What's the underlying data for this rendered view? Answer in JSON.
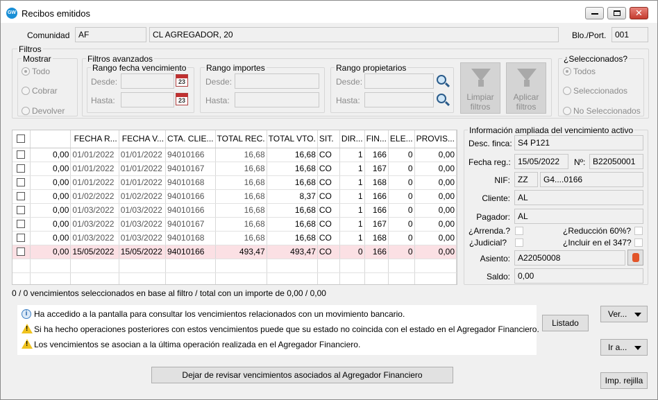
{
  "window": {
    "title": "Recibos emitidos",
    "app_icon_text": "GW"
  },
  "header": {
    "comunidad_label": "Comunidad",
    "comunidad_code": "AF",
    "comunidad_name": "CL AGREGADOR, 20",
    "bloport_label": "Blo./Port.",
    "bloport_value": "001"
  },
  "filtros": {
    "title": "Filtros",
    "mostrar": {
      "title": "Mostrar",
      "options": [
        "Todo",
        "Cobrar",
        "Devolver"
      ],
      "selected": "Todo"
    },
    "avanzados_title": "Filtros avanzados",
    "rango_fecha": {
      "title": "Rango fecha vencimiento",
      "desde": "Desde:",
      "hasta": "Hasta:",
      "cal_text": "23"
    },
    "rango_importes": {
      "title": "Rango importes",
      "desde": "Desde:",
      "hasta": "Hasta:"
    },
    "rango_propietarios": {
      "title": "Rango propietarios",
      "desde": "Desde:",
      "hasta": "Hasta:"
    },
    "limpiar_label_1": "Limpiar",
    "limpiar_label_2": "filtros",
    "aplicar_label_1": "Aplicar",
    "aplicar_label_2": "filtros",
    "seleccionados": {
      "title": "¿Seleccionados?",
      "options": [
        "Todos",
        "Seleccionados",
        "No Seleccionados"
      ],
      "selected": "Todos"
    }
  },
  "grid": {
    "columns": [
      "",
      "",
      "FECHA R...",
      "FECHA V...",
      "CTA. CLIE...",
      "TOTAL REC.",
      "TOTAL VTO.",
      "SIT.",
      "DIR...",
      "FIN...",
      "ELE...",
      "PROVIS..."
    ],
    "rows": [
      {
        "importe": "0,00",
        "fecha_r": "01/01/2022",
        "fecha_v": "01/01/2022",
        "cta": "94010166",
        "total_rec": "16,68",
        "total_vto": "16,68",
        "sit": "CO",
        "dir": "1",
        "fin": "166",
        "ele": "0",
        "provis": "0,00",
        "hl": false
      },
      {
        "importe": "0,00",
        "fecha_r": "01/01/2022",
        "fecha_v": "01/01/2022",
        "cta": "94010167",
        "total_rec": "16,68",
        "total_vto": "16,68",
        "sit": "CO",
        "dir": "1",
        "fin": "167",
        "ele": "0",
        "provis": "0,00",
        "hl": false
      },
      {
        "importe": "0,00",
        "fecha_r": "01/01/2022",
        "fecha_v": "01/01/2022",
        "cta": "94010168",
        "total_rec": "16,68",
        "total_vto": "16,68",
        "sit": "CO",
        "dir": "1",
        "fin": "168",
        "ele": "0",
        "provis": "0,00",
        "hl": false
      },
      {
        "importe": "0,00",
        "fecha_r": "01/02/2022",
        "fecha_v": "01/02/2022",
        "cta": "94010166",
        "total_rec": "16,68",
        "total_vto": "8,37",
        "sit": "CO",
        "dir": "1",
        "fin": "166",
        "ele": "0",
        "provis": "0,00",
        "hl": false
      },
      {
        "importe": "0,00",
        "fecha_r": "01/03/2022",
        "fecha_v": "01/03/2022",
        "cta": "94010166",
        "total_rec": "16,68",
        "total_vto": "16,68",
        "sit": "CO",
        "dir": "1",
        "fin": "166",
        "ele": "0",
        "provis": "0,00",
        "hl": false
      },
      {
        "importe": "0,00",
        "fecha_r": "01/03/2022",
        "fecha_v": "01/03/2022",
        "cta": "94010167",
        "total_rec": "16,68",
        "total_vto": "16,68",
        "sit": "CO",
        "dir": "1",
        "fin": "167",
        "ele": "0",
        "provis": "0,00",
        "hl": false
      },
      {
        "importe": "0,00",
        "fecha_r": "01/03/2022",
        "fecha_v": "01/03/2022",
        "cta": "94010168",
        "total_rec": "16,68",
        "total_vto": "16,68",
        "sit": "CO",
        "dir": "1",
        "fin": "168",
        "ele": "0",
        "provis": "0,00",
        "hl": false
      },
      {
        "importe": "0,00",
        "fecha_r": "15/05/2022",
        "fecha_v": "15/05/2022",
        "cta": "94010166",
        "total_rec": "493,47",
        "total_vto": "493,47",
        "sit": "CO",
        "dir": "0",
        "fin": "166",
        "ele": "0",
        "provis": "0,00",
        "hl": true
      }
    ],
    "highlight_color": "#fbe0e4"
  },
  "summary_text": "0 / 0 vencimientos seleccionados en base al filtro / total con un importe de 0,00 / 0,00",
  "info_panel": {
    "title": "Información ampliada del vencimiento activo",
    "desc_finca_label": "Desc. finca:",
    "desc_finca": "S4 P121",
    "fecha_reg_label": "Fecha reg.:",
    "fecha_reg": "15/05/2022",
    "num_label": "Nº:",
    "num": "B22050001",
    "nif_label": "NIF:",
    "nif_a": "ZZ",
    "nif_b": "G4....0166",
    "cliente_label": "Cliente:",
    "cliente": "AL",
    "pagador_label": "Pagador:",
    "pagador": "AL",
    "arrenda_label": "¿Arrenda.?",
    "reduccion_label": "¿Reducción 60%?",
    "judicial_label": "¿Judicial?",
    "incluir_label": "¿Incluir en el 347?",
    "asiento_label": "Asiento:",
    "asiento": "A22050008",
    "saldo_label": "Saldo:",
    "saldo": "0,00"
  },
  "messages": [
    {
      "icon": "info-icon",
      "text": "Ha accedido a la pantalla para consultar los vencimientos relacionados con un movimiento bancario."
    },
    {
      "icon": "warning-icon",
      "text": "Si ha hecho operaciones posteriores con estos vencimientos puede que su estado no coincida con el estado en el Agregador Financiero."
    },
    {
      "icon": "warning-icon",
      "text": "Los vencimientos se asocian a la última operación realizada en el Agregador Financiero."
    }
  ],
  "buttons": {
    "listado": "Listado",
    "ver": "Ver...",
    "ir_a": "Ir a...",
    "dejar": "Dejar de revisar vencimientos asociados al Agregador Financiero",
    "imp_rejilla": "Imp. rejilla"
  }
}
